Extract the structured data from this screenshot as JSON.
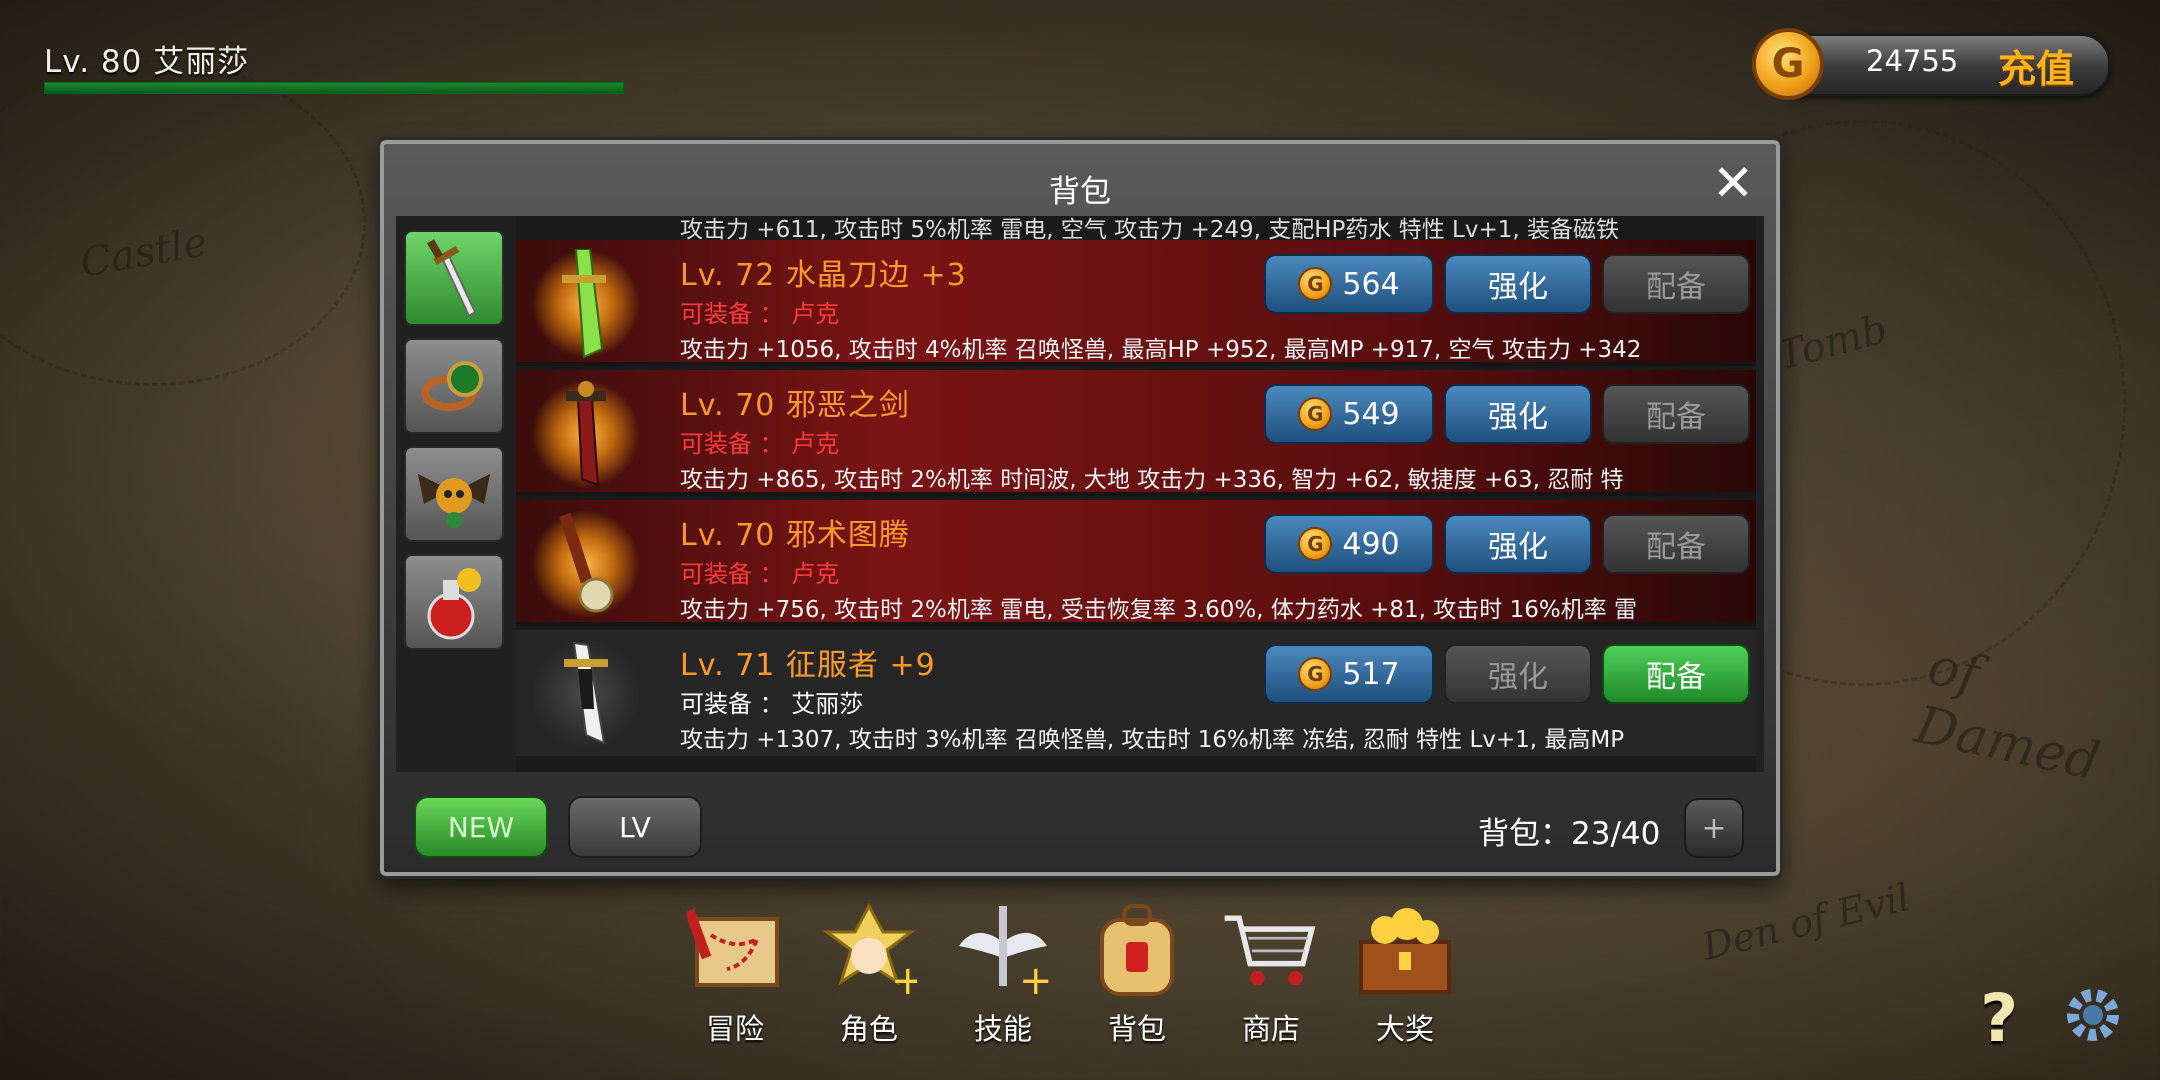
{
  "player": {
    "level_name": "Lv. 80  艾丽莎",
    "xp_fraction": 1.0
  },
  "currency": {
    "gold": "24755",
    "recharge_label": "充值",
    "coin_glyph": "G"
  },
  "panel": {
    "title": "背包",
    "close_glyph": "✕"
  },
  "tabs": [
    {
      "name": "weapons",
      "icon": "sword-icon",
      "active": true
    },
    {
      "name": "accessories",
      "icon": "ring-icon",
      "active": false
    },
    {
      "name": "pets",
      "icon": "dragon-pet-icon",
      "active": false
    },
    {
      "name": "potions",
      "icon": "potion-icon",
      "active": false
    }
  ],
  "partial_row": {
    "stats": "攻击力 +611, 攻击时 5%机率 雷电, 空气 攻击力 +249, 支配HP药水 特性 Lv+1, 装备磁铁"
  },
  "items": [
    {
      "title": "Lv. 72  水晶刀边  +3",
      "equip": "可装备 ： 卢克",
      "stats": "攻击力 +1056, 攻击时 4%机率 召唤怪兽, 最高HP +952, 最高MP +917, 空气 攻击力 +342",
      "price": "564",
      "upgrade": "强化",
      "equip_btn": "配备",
      "icon": "crystal-blade-icon"
    },
    {
      "title": "Lv. 70  邪恶之剑",
      "equip": "可装备 ： 卢克",
      "stats": "攻击力 +865, 攻击时 2%机率 时间波, 大地 攻击力 +336, 智力 +62, 敏捷度 +63, 忍耐 特",
      "price": "549",
      "upgrade": "强化",
      "equip_btn": "配备",
      "icon": "evil-sword-icon"
    },
    {
      "title": "Lv. 70  邪术图腾",
      "equip": "可装备 ： 卢克",
      "stats": "攻击力 +756, 攻击时 2%机率 雷电, 受击恢复率 3.60%, 体力药水 +81, 攻击时 16%机率 雷",
      "price": "490",
      "upgrade": "强化",
      "equip_btn": "配备",
      "icon": "totem-staff-icon"
    },
    {
      "title": "Lv. 71  征服者  +9",
      "equip": "可装备 ： 艾丽莎",
      "stats": "攻击力 +1307, 攻击时 3%机率 召唤怪兽, 攻击时 16%机率 冻结, 忍耐 特性 Lv+1, 最高MP",
      "price": "517",
      "upgrade": "强化",
      "equip_btn": "配备",
      "icon": "conqueror-sword-icon"
    }
  ],
  "bottom": {
    "sort_new": "NEW",
    "sort_lv": "LV",
    "bag_count": "背包：23/40",
    "expand": "+"
  },
  "nav": [
    {
      "label": "冒险",
      "icon": "map-scroll-icon"
    },
    {
      "label": "角色",
      "icon": "character-icon"
    },
    {
      "label": "技能",
      "icon": "skill-wings-icon"
    },
    {
      "label": "背包",
      "icon": "backpack-icon"
    },
    {
      "label": "商店",
      "icon": "shopping-cart-icon"
    },
    {
      "label": "大奖",
      "icon": "treasure-chest-icon"
    }
  ],
  "help_glyph": "?",
  "colors": {
    "accent_gold": "#ffb21a",
    "item_title": "#ff9a2a",
    "equip_warning": "#ff3a3a",
    "equip_active": "#2f9a38",
    "upgrade_blue": "#2f6fa8"
  }
}
